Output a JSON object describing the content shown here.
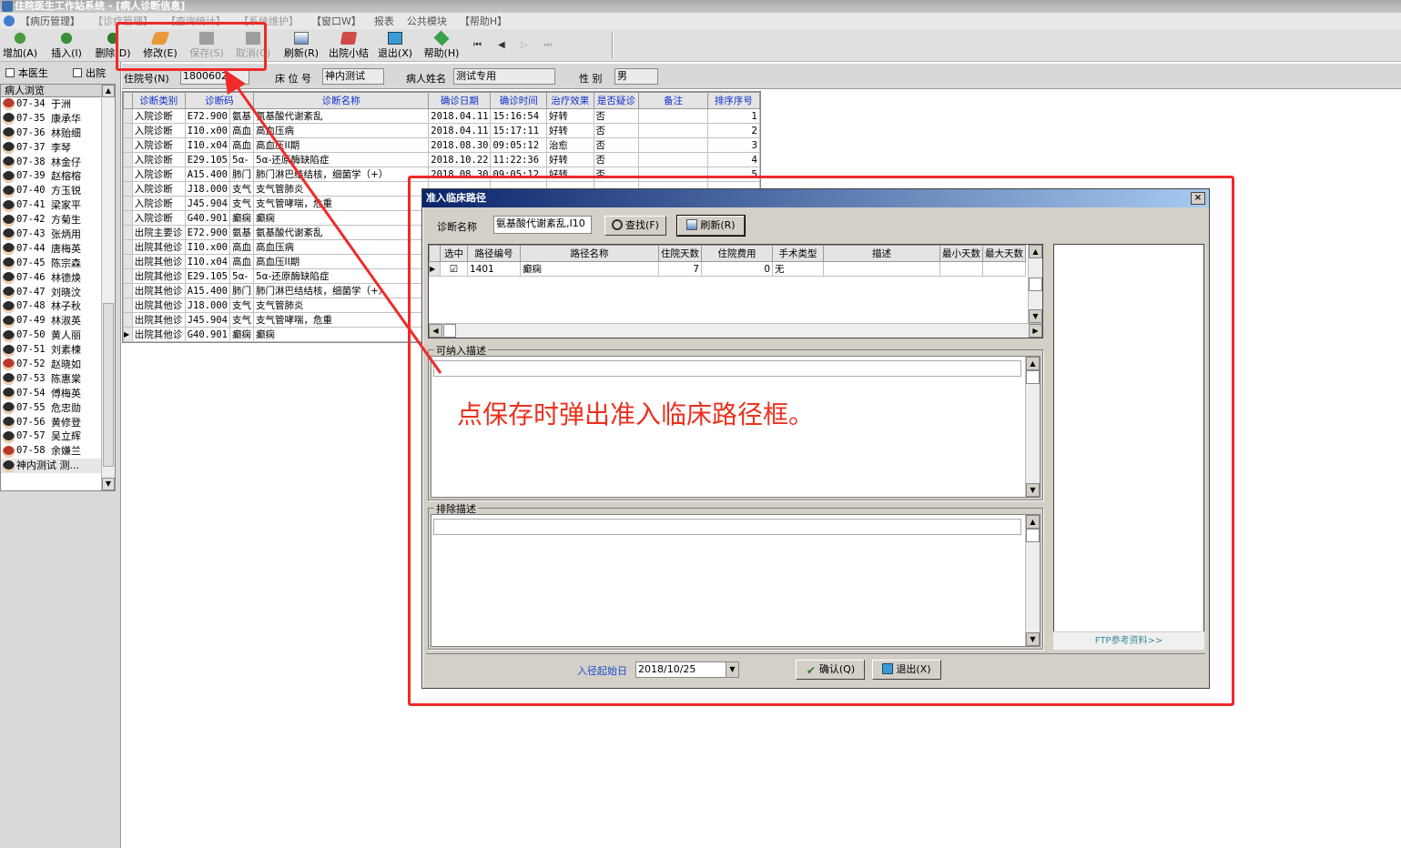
{
  "window": {
    "title": "住院医生工作站系统 - [病人诊断信息]"
  },
  "menu": [
    "【病历管理】",
    "【诊疗管理】",
    "【查询统计】",
    "【系统维护】",
    "【窗口W】",
    "报表",
    "公共模块",
    "【帮助H】"
  ],
  "toolbar": {
    "add": "增加(A)",
    "insert": "插入(I)",
    "delete": "删除(D)",
    "modify": "修改(E)",
    "save": "保存(S)",
    "cancel": "取消(C)",
    "refresh": "刷新(R)",
    "discharge_summary": "出院小结",
    "exit": "退出(X)",
    "help": "帮助(H)",
    "nav": [
      "⏮",
      "◀",
      "▷",
      "⏭"
    ]
  },
  "left": {
    "this_doctor": "本医生",
    "discharged": "出院",
    "list_header": "病人浏览",
    "patients": [
      {
        "bed": "07-34",
        "name": "于洲",
        "red": true
      },
      {
        "bed": "07-35",
        "name": "康承华",
        "red": false
      },
      {
        "bed": "07-36",
        "name": "林贻细",
        "red": false
      },
      {
        "bed": "07-37",
        "name": "李琴",
        "red": false
      },
      {
        "bed": "07-38",
        "name": "林金仔",
        "red": false
      },
      {
        "bed": "07-39",
        "name": "赵榕榕",
        "red": false
      },
      {
        "bed": "07-40",
        "name": "方玉锐",
        "red": false
      },
      {
        "bed": "07-41",
        "name": "梁家平",
        "red": false
      },
      {
        "bed": "07-42",
        "name": "方菊生",
        "red": false
      },
      {
        "bed": "07-43",
        "name": "张炳用",
        "red": false
      },
      {
        "bed": "07-44",
        "name": "唐梅英",
        "red": false
      },
      {
        "bed": "07-45",
        "name": "陈宗森",
        "red": false
      },
      {
        "bed": "07-46",
        "name": "林德焕",
        "red": false
      },
      {
        "bed": "07-47",
        "name": "刘晓汶",
        "red": false
      },
      {
        "bed": "07-48",
        "name": "林子秋",
        "red": false
      },
      {
        "bed": "07-49",
        "name": "林淑英",
        "red": false
      },
      {
        "bed": "07-50",
        "name": "黄人丽",
        "red": false
      },
      {
        "bed": "07-51",
        "name": "刘素楝",
        "red": false
      },
      {
        "bed": "07-52",
        "name": "赵晓如",
        "red": true
      },
      {
        "bed": "07-53",
        "name": "陈惠棠",
        "red": false
      },
      {
        "bed": "07-54",
        "name": "傅梅英",
        "red": false
      },
      {
        "bed": "07-55",
        "name": "危忠勋",
        "red": false
      },
      {
        "bed": "07-56",
        "name": "黄修登",
        "red": false
      },
      {
        "bed": "07-57",
        "name": "吴立辉",
        "red": false
      },
      {
        "bed": "07-58",
        "name": "余嫌兰",
        "red": true
      },
      {
        "bed": "",
        "name": "神内测试 测...",
        "red": false
      }
    ]
  },
  "info": {
    "admission_no_label": "住院号(N)",
    "admission_no": "1800602",
    "bed_label": "床 位 号",
    "bed": "神内测试",
    "name_label": "病人姓名",
    "name": "测试专用",
    "sex_label": "性  别",
    "sex": "男"
  },
  "diagnosis": {
    "columns": [
      "诊断类别",
      "诊断码",
      "诊断名称",
      "确诊日期",
      "确诊时间",
      "治疗效果",
      "是否疑诊",
      "备注",
      "排序序号"
    ],
    "rows": [
      [
        "入院诊断",
        "E72.900",
        "氨基",
        "氨基酸代谢紊乱",
        "2018.04.11",
        "15:16:54",
        "好转",
        "否",
        "",
        "1"
      ],
      [
        "入院诊断",
        "I10.x00",
        "高血",
        "高血压病",
        "2018.04.11",
        "15:17:11",
        "好转",
        "否",
        "",
        "2"
      ],
      [
        "入院诊断",
        "I10.x04",
        "高血",
        "高血压II期",
        "2018.08.30",
        "09:05:12",
        "治愈",
        "否",
        "",
        "3"
      ],
      [
        "入院诊断",
        "E29.105",
        "5α-",
        "5α-还原酶缺陷症",
        "2018.10.22",
        "11:22:36",
        "好转",
        "否",
        "",
        "4"
      ],
      [
        "入院诊断",
        "A15.400",
        "肺门",
        "肺门淋巴结结核，细菌学（+）",
        "2018.08.30",
        "09:05:12",
        "好转",
        "否",
        "",
        "5"
      ],
      [
        "入院诊断",
        "J18.000",
        "支气",
        "支气管肺炎",
        "",
        "",
        "",
        "",
        "",
        ""
      ],
      [
        "入院诊断",
        "J45.904",
        "支气",
        "支气管哮喘，危重",
        "",
        "",
        "",
        "",
        "",
        ""
      ],
      [
        "入院诊断",
        "G40.901",
        "癫痫",
        "癫痫",
        "",
        "",
        "",
        "",
        "",
        ""
      ],
      [
        "出院主要诊",
        "E72.900",
        "氨基",
        "氨基酸代谢紊乱",
        "",
        "",
        "",
        "",
        "",
        ""
      ],
      [
        "出院其他诊",
        "I10.x00",
        "高血",
        "高血压病",
        "",
        "",
        "",
        "",
        "",
        ""
      ],
      [
        "出院其他诊",
        "I10.x04",
        "高血",
        "高血压II期",
        "",
        "",
        "",
        "",
        "",
        ""
      ],
      [
        "出院其他诊",
        "E29.105",
        "5α-",
        "5α-还原酶缺陷症",
        "",
        "",
        "",
        "",
        "",
        ""
      ],
      [
        "出院其他诊",
        "A15.400",
        "肺门",
        "肺门淋巴结结核，细菌学（+）",
        "",
        "",
        "",
        "",
        "",
        ""
      ],
      [
        "出院其他诊",
        "J18.000",
        "支气",
        "支气管肺炎",
        "",
        "",
        "",
        "",
        "",
        ""
      ],
      [
        "出院其他诊",
        "J45.904",
        "支气",
        "支气管哮喘，危重",
        "",
        "",
        "",
        "",
        "",
        ""
      ],
      [
        "出院其他诊",
        "G40.901",
        "癫痫",
        "癫痫",
        "",
        "",
        "",
        "",
        "",
        ""
      ]
    ]
  },
  "dialog": {
    "title": "准入临床路径",
    "close": "×",
    "diag_label": "诊断名称",
    "diag_value": "氨基酸代谢紊乱,I10",
    "find": "查找(F)",
    "refresh": "刷新(R)",
    "grid_columns": [
      "选中",
      "路径编号",
      "路径名称",
      "住院天数",
      "住院费用",
      "手术类型",
      "描述",
      "最小天数",
      "最大天数"
    ],
    "grid_rows": [
      {
        "checked": "☑",
        "id": "1401",
        "name": "癫痫",
        "days": "7",
        "cost": "0",
        "op": "无",
        "desc": "",
        "min": "",
        "max": ""
      }
    ],
    "include_label": "可纳入描述",
    "exclude_label": "排除描述",
    "ftp_link": "FTP参考资料>>",
    "start_label": "入径起始日",
    "start_date": "2018/10/25",
    "confirm": "确认(Q)",
    "exit": "退出(X)"
  },
  "annotation": {
    "text": "点保存时弹出准入临床路径框。",
    "color": "#ee2a2a"
  }
}
